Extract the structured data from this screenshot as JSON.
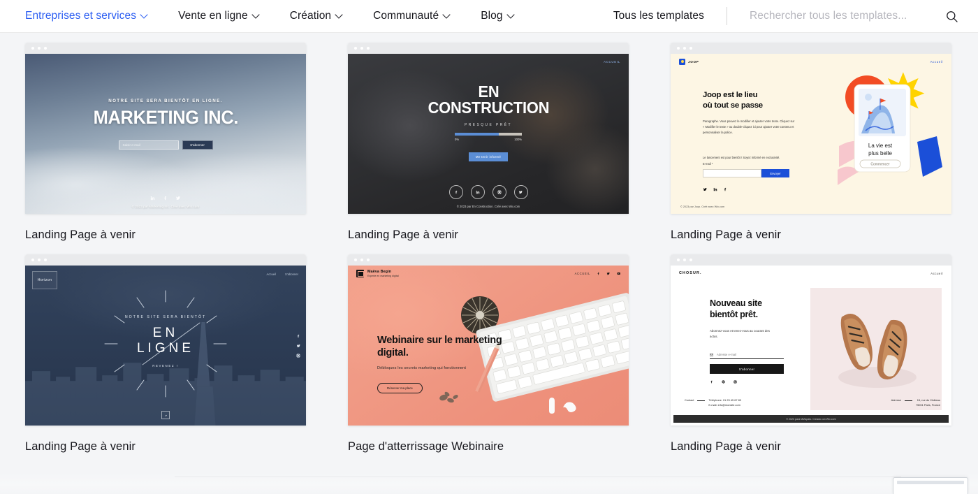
{
  "nav": {
    "items": [
      {
        "label": "Entreprises et services",
        "has_caret": true,
        "active": true
      },
      {
        "label": "Vente en ligne",
        "has_caret": true,
        "active": false
      },
      {
        "label": "Création",
        "has_caret": true,
        "active": false
      },
      {
        "label": "Communauté",
        "has_caret": true,
        "active": false
      },
      {
        "label": "Blog",
        "has_caret": true,
        "active": false
      }
    ],
    "all_templates_label": "Tous les templates",
    "search_placeholder": "Rechercher tous les templates...",
    "search_value": "",
    "active_color": "#2b5df2"
  },
  "cards": [
    {
      "title": "Landing Page à venir",
      "template": "marketing-inc",
      "content": {
        "eyebrow": "NOTRE SITE SERA BIENTÔT EN LIGNE.",
        "heading": "MARKETING INC.",
        "email_placeholder": "Saisir e-mail",
        "submit_label": "S'abonner",
        "socials": [
          "linkedin",
          "facebook",
          "twitter"
        ],
        "copyright": "© 2023 par Marketing Inc. Créé avec Wix.com"
      }
    },
    {
      "title": "Landing Page à venir",
      "template": "en-construction",
      "content": {
        "nav_link": "ACCUEIL",
        "heading_line1": "EN",
        "heading_line2": "CONSTRUCTION",
        "subheading": "PRESQUE PRÊT",
        "progress_percent": 66,
        "progress_min_label": "0%",
        "progress_max_label": "100%",
        "cta_label": "Me tenir informé",
        "socials": [
          "facebook",
          "linkedin",
          "instagram",
          "twitter"
        ],
        "copyright": "© 2023 par En Construction. Créé avec Wix.com"
      }
    },
    {
      "title": "Landing Page à venir",
      "template": "joop",
      "content": {
        "logo_text": "JOOP",
        "nav_link": "Accueil",
        "heading_line1": "Joop est le lieu",
        "heading_line2": "où tout se passe",
        "paragraph": "Paragraphe. Vous pouvez le modifier et ajouter votre texte. Cliquez sur « Modifier le texte » ou double-cliquez ici pour ajouter votre contenu et personnaliser la police.",
        "launch_note": "Le lancement est pour bientôt ! Soyez informé en exclusivité.",
        "email_label": "E-mail *",
        "submit_label": "Envoyer",
        "socials": [
          "twitter",
          "linkedin",
          "facebook"
        ],
        "phone_headline_line1": "La vie est",
        "phone_headline_line2": "plus belle",
        "phone_cta": "Commencer",
        "copyright": "© 2023 par Joop. Créé avec Wix.com",
        "accent_orange": "#f24c24",
        "accent_blue": "#1b4fd8",
        "accent_yellow": "#ffd300",
        "accent_pink": "#f7c7cd",
        "background": "#fdf6e4"
      }
    },
    {
      "title": "Landing Page à venir",
      "template": "horizon",
      "content": {
        "logo_text": "Horizon",
        "nav_links": [
          "Accueil",
          "S'abonner"
        ],
        "eyebrow": "NOTRE SITE SERA BIENTÔT",
        "heading_line1": "EN",
        "heading_line2": "LIGNE",
        "footer_note": "REVENEZ !",
        "socials": [
          "facebook",
          "twitter",
          "instagram"
        ]
      }
    },
    {
      "title": "Page d'atterrissage Webinaire",
      "template": "webinaire",
      "content": {
        "brand_name": "Maëva Begin",
        "brand_tagline": "Experte en marketing digital",
        "nav_link": "ACCUEIL",
        "heading": "Webinaire sur le marketing digital.",
        "subheading": "Débloquez les secrets marketing qui fonctionnent",
        "cta_label": "Réserver ma place",
        "socials": [
          "facebook",
          "twitter",
          "youtube"
        ],
        "background": "#ef9580"
      }
    },
    {
      "title": "Landing Page à venir",
      "template": "chosur",
      "content": {
        "brand": "CHOSUR.",
        "nav_link": "Accueil",
        "heading_line1": "Nouveau site",
        "heading_line2": "bientôt prêt.",
        "paragraph": "Abonnez-vous et tenez-vous au courant des actus.",
        "email_placeholder": "Adresse e-mail",
        "submit_label": "S'abonner",
        "socials": [
          "facebook",
          "pinterest",
          "instagram"
        ],
        "contact_label": "Contact",
        "contact_phone": "Téléphone. 01 23 45 67 89",
        "contact_email": "E-mail. info@monsite.com",
        "address_label": "Adresse",
        "address_line1": "15, rue du Château",
        "address_line2": "75001 Paris, France",
        "copyright": "© 2023 para MiZapato. Creado con Wix.com"
      }
    }
  ]
}
